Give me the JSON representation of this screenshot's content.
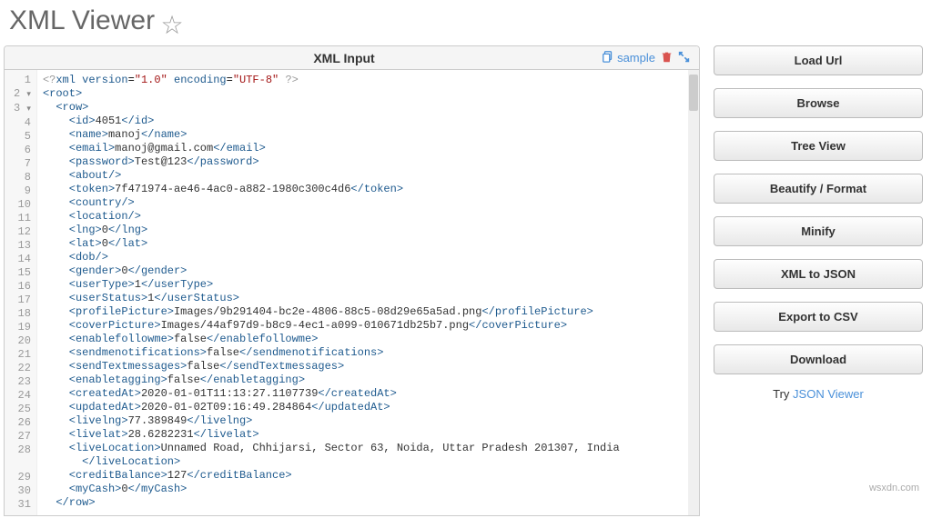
{
  "header": {
    "title": "XML Viewer"
  },
  "editor": {
    "title": "XML Input",
    "sample_label": "sample",
    "lines": [
      {
        "n": "1",
        "indent": 0,
        "type": "pi",
        "content": "<?xml version=\"1.0\" encoding=\"UTF-8\" ?>"
      },
      {
        "n": "2",
        "indent": 0,
        "type": "open",
        "fold": true,
        "tag": "root"
      },
      {
        "n": "3",
        "indent": 1,
        "type": "open",
        "fold": true,
        "tag": "row"
      },
      {
        "n": "4",
        "indent": 2,
        "type": "elem",
        "tag": "id",
        "text": "4051"
      },
      {
        "n": "5",
        "indent": 2,
        "type": "elem",
        "tag": "name",
        "text": "manoj"
      },
      {
        "n": "6",
        "indent": 2,
        "type": "elem",
        "tag": "email",
        "text": "manoj@gmail.com"
      },
      {
        "n": "7",
        "indent": 2,
        "type": "elem",
        "tag": "password",
        "text": "Test@123"
      },
      {
        "n": "8",
        "indent": 2,
        "type": "self",
        "tag": "about"
      },
      {
        "n": "9",
        "indent": 2,
        "type": "elem",
        "tag": "token",
        "text": "7f471974-ae46-4ac0-a882-1980c300c4d6"
      },
      {
        "n": "10",
        "indent": 2,
        "type": "self",
        "tag": "country"
      },
      {
        "n": "11",
        "indent": 2,
        "type": "self",
        "tag": "location"
      },
      {
        "n": "12",
        "indent": 2,
        "type": "elem",
        "tag": "lng",
        "text": "0"
      },
      {
        "n": "13",
        "indent": 2,
        "type": "elem",
        "tag": "lat",
        "text": "0"
      },
      {
        "n": "14",
        "indent": 2,
        "type": "self",
        "tag": "dob"
      },
      {
        "n": "15",
        "indent": 2,
        "type": "elem",
        "tag": "gender",
        "text": "0"
      },
      {
        "n": "16",
        "indent": 2,
        "type": "elem",
        "tag": "userType",
        "text": "1"
      },
      {
        "n": "17",
        "indent": 2,
        "type": "elem",
        "tag": "userStatus",
        "text": "1"
      },
      {
        "n": "18",
        "indent": 2,
        "type": "elem",
        "tag": "profilePicture",
        "text": "Images/9b291404-bc2e-4806-88c5-08d29e65a5ad.png"
      },
      {
        "n": "19",
        "indent": 2,
        "type": "elem",
        "tag": "coverPicture",
        "text": "Images/44af97d9-b8c9-4ec1-a099-010671db25b7.png"
      },
      {
        "n": "20",
        "indent": 2,
        "type": "elem",
        "tag": "enablefollowme",
        "text": "false"
      },
      {
        "n": "21",
        "indent": 2,
        "type": "elem",
        "tag": "sendmenotifications",
        "text": "false"
      },
      {
        "n": "22",
        "indent": 2,
        "type": "elem",
        "tag": "sendTextmessages",
        "text": "false"
      },
      {
        "n": "23",
        "indent": 2,
        "type": "elem",
        "tag": "enabletagging",
        "text": "false"
      },
      {
        "n": "24",
        "indent": 2,
        "type": "elem",
        "tag": "createdAt",
        "text": "2020-01-01T11:13:27.1107739"
      },
      {
        "n": "25",
        "indent": 2,
        "type": "elem",
        "tag": "updatedAt",
        "text": "2020-01-02T09:16:49.284864"
      },
      {
        "n": "26",
        "indent": 2,
        "type": "elem",
        "tag": "livelng",
        "text": "77.389849"
      },
      {
        "n": "27",
        "indent": 2,
        "type": "elem",
        "tag": "livelat",
        "text": "28.6282231"
      },
      {
        "n": "28",
        "indent": 2,
        "type": "elem-wrap",
        "tag": "liveLocation",
        "text": "Unnamed Road, Chhijarsi, Sector 63, Noida, Uttar Pradesh 201307, India"
      },
      {
        "n": "29",
        "indent": 2,
        "type": "elem",
        "tag": "creditBalance",
        "text": "127"
      },
      {
        "n": "30",
        "indent": 2,
        "type": "elem",
        "tag": "myCash",
        "text": "0"
      },
      {
        "n": "31",
        "indent": 1,
        "type": "close",
        "tag": "row"
      }
    ]
  },
  "sidebar": {
    "buttons": [
      {
        "key": "load-url",
        "label": "Load Url"
      },
      {
        "key": "browse",
        "label": "Browse"
      },
      {
        "key": "tree-view",
        "label": "Tree View"
      },
      {
        "key": "beautify",
        "label": "Beautify / Format"
      },
      {
        "key": "minify",
        "label": "Minify"
      },
      {
        "key": "to-json",
        "label": "XML to JSON"
      },
      {
        "key": "to-csv",
        "label": "Export to CSV"
      },
      {
        "key": "download",
        "label": "Download"
      }
    ],
    "try_prefix": "Try ",
    "try_link": "JSON Viewer"
  },
  "watermark": "wsxdn.com"
}
